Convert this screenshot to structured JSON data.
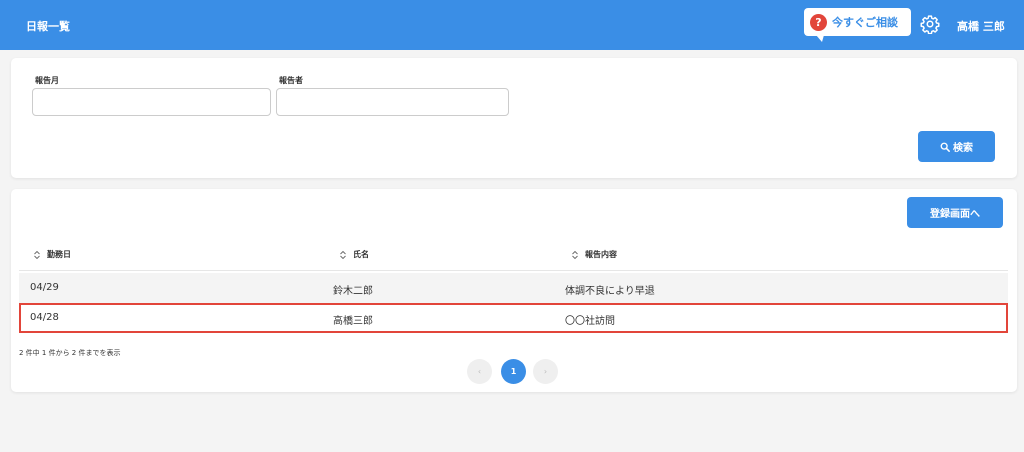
{
  "header": {
    "title": "日報一覧",
    "consult_label": "今すぐご相談",
    "help_symbol": "?",
    "user_name": "高橋 三郎"
  },
  "search": {
    "month_label": "報告月",
    "month_value": "",
    "reporter_label": "報告者",
    "reporter_value": "",
    "button_label": "検索"
  },
  "list": {
    "register_label": "登録画面へ",
    "columns": [
      "勤務日",
      "氏名",
      "報告内容"
    ],
    "rows": [
      {
        "date": "04/29",
        "name": "鈴木二郎",
        "content": "体調不良により早退"
      },
      {
        "date": "04/28",
        "name": "高橋三郎",
        "content": "〇〇社訪問"
      }
    ],
    "summary": "2 件中 1 件から 2 件までを表示",
    "pagination": {
      "prev": "‹",
      "current": "1",
      "next": "›"
    }
  },
  "colors": {
    "primary": "#3a8ee6",
    "highlight": "#e2453a",
    "background": "#f4f4f4"
  },
  "icons": {
    "help": "help-icon",
    "settings": "gear-icon",
    "search": "search-icon",
    "sort": "sort-icon"
  }
}
